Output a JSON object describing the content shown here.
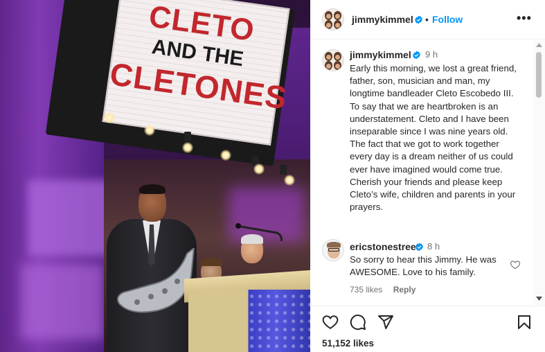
{
  "photo": {
    "marquee_line1": "CLETO",
    "marquee_line2": "AND THE",
    "marquee_line3": "CLETONES"
  },
  "post": {
    "author": "jimmykimmel",
    "follow_label": "Follow",
    "separator": "•",
    "more_label": "•••"
  },
  "caption": {
    "username": "jimmykimmel",
    "time": "9 h",
    "text": "Early this morning, we lost a great friend, father, son, musician and man, my longtime bandleader Cleto Escobedo III. To say that we are heartbroken is an understatement. Cleto and I have been inseparable since I was nine years old. The fact that we got to work together every day is a dream neither of us could ever have imagined would come true. Cherish your friends and please keep Cleto’s wife, children and parents in your prayers."
  },
  "comment": {
    "username": "ericstonestreet",
    "time": "8 h",
    "text": "So sorry to hear this Jimmy. He was AWESOME. Love to his family.",
    "likes": "735 likes",
    "reply_label": "Reply"
  },
  "footer": {
    "likes_count": "51,152 likes"
  },
  "icons": {
    "like": "heart-icon",
    "comment": "comment-icon",
    "share": "paper-plane-icon",
    "save": "bookmark-icon",
    "verified": "verified-badge-icon",
    "more": "more-options-icon"
  },
  "colors": {
    "accent": "#0095f6",
    "verified": "#0095f6",
    "text": "#262626",
    "muted": "#737373"
  }
}
